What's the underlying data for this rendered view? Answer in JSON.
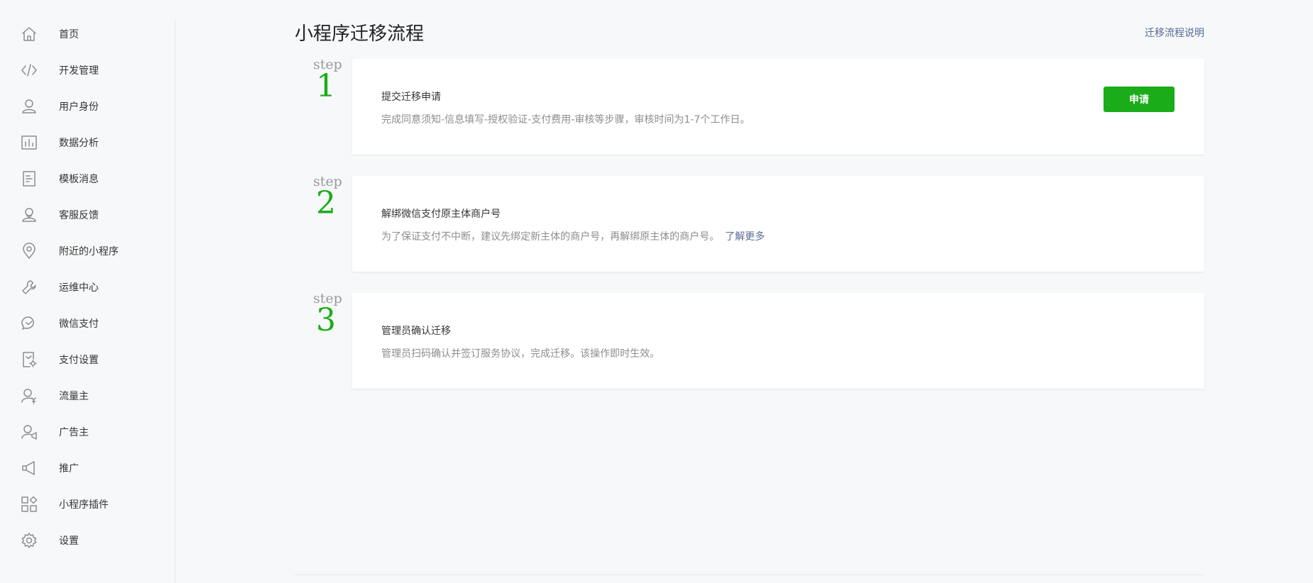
{
  "sidebar": {
    "items": [
      {
        "label": "首页",
        "icon": "home-icon"
      },
      {
        "label": "开发管理",
        "icon": "code-icon"
      },
      {
        "label": "用户身份",
        "icon": "user-icon"
      },
      {
        "label": "数据分析",
        "icon": "bar-chart-icon"
      },
      {
        "label": "模板消息",
        "icon": "document-icon"
      },
      {
        "label": "客服反馈",
        "icon": "customer-service-icon"
      },
      {
        "label": "附近的小程序",
        "icon": "location-pin-icon"
      },
      {
        "label": "运维中心",
        "icon": "wrench-icon"
      },
      {
        "label": "微信支付",
        "icon": "wechat-pay-icon"
      },
      {
        "label": "支付设置",
        "icon": "payment-settings-icon"
      },
      {
        "label": "流量主",
        "icon": "traffic-owner-icon"
      },
      {
        "label": "广告主",
        "icon": "advertiser-icon"
      },
      {
        "label": "推广",
        "icon": "megaphone-icon"
      },
      {
        "label": "小程序插件",
        "icon": "plugin-icon"
      },
      {
        "label": "设置",
        "icon": "gear-icon"
      }
    ]
  },
  "header": {
    "title": "小程序迁移流程",
    "help_link": "迁移流程说明"
  },
  "steps": [
    {
      "word": "step",
      "number": "1",
      "title": "提交迁移申请",
      "description": "完成同意须知-信息填写-授权验证-支付费用-审核等步骤，审核时间为1-7个工作日。",
      "button_label": "申请"
    },
    {
      "word": "step",
      "number": "2",
      "title": "解绑微信支付原主体商户号",
      "description": "为了保证支付不中断，建议先绑定新主体的商户号，再解绑原主体的商户号。",
      "link_label": "了解更多"
    },
    {
      "word": "step",
      "number": "3",
      "title": "管理员确认迁移",
      "description": "管理员扫码确认并签订服务协议，完成迁移。该操作即时生效。"
    }
  ],
  "colors": {
    "accent_green": "#1aad19",
    "link_blue": "#576b95",
    "background": "#f6f8f9"
  }
}
